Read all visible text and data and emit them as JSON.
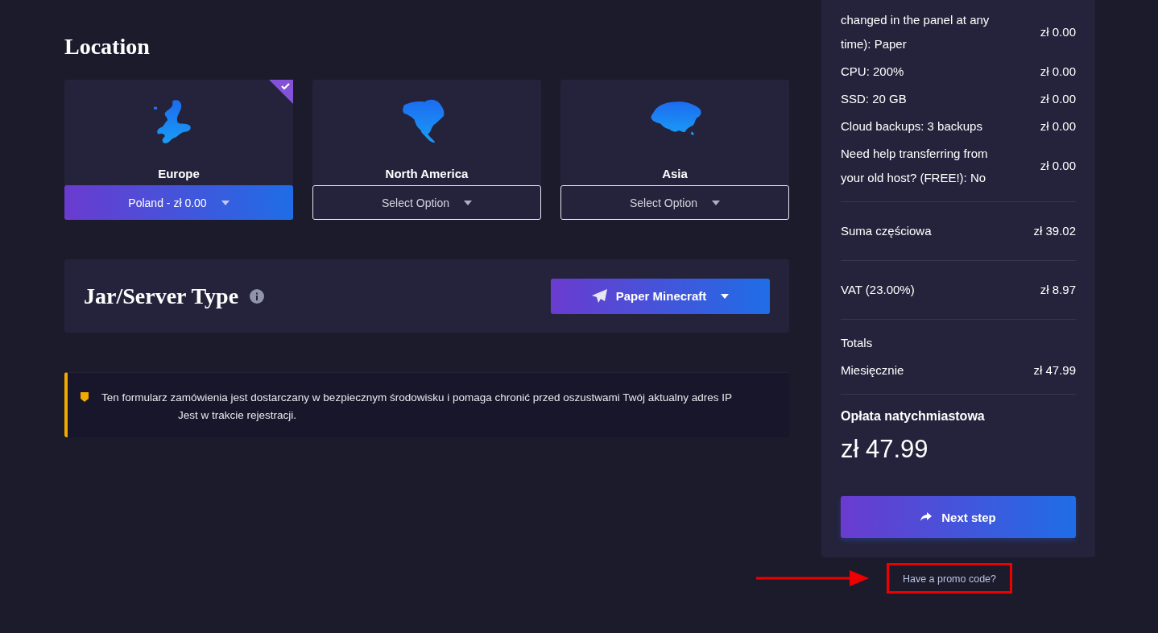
{
  "location": {
    "heading": "Location",
    "regions": [
      {
        "name": "Europe",
        "selected": true,
        "option": "Poland - zł 0.00"
      },
      {
        "name": "North America",
        "selected": false,
        "option": "Select Option"
      },
      {
        "name": "Asia",
        "selected": false,
        "option": "Select Option"
      }
    ]
  },
  "server_type": {
    "heading": "Jar/Server Type",
    "value": "Paper Minecraft"
  },
  "notice": {
    "text": "Ten formularz zamówienia jest dostarczany w bezpiecznym środowisku i pomaga chronić przed oszustwami Twój aktualny adres IP",
    "ip_text": "Jest w trakcie rejestracji."
  },
  "summary": {
    "items": [
      {
        "label": "changed in the panel at any time): Paper",
        "price": "zł 0.00"
      },
      {
        "label": "CPU: 200%",
        "price": "zł 0.00"
      },
      {
        "label": "SSD: 20 GB",
        "price": "zł 0.00"
      },
      {
        "label": "Cloud backups: 3 backups",
        "price": "zł 0.00"
      },
      {
        "label": "Need help transferring from your old host? (FREE!): No",
        "price": "zł 0.00"
      }
    ],
    "subtotal": {
      "label": "Suma częściowa",
      "value": "zł 39.02"
    },
    "tax": {
      "label": "VAT (23.00%)",
      "value": "zł 8.97"
    },
    "totals_heading": "Totals",
    "monthly": {
      "label": "Miesięcznie",
      "value": "zł 47.99"
    },
    "due_label": "Opłata natychmiastowa",
    "due_amount": "zł 47.99",
    "next_button": "Next step"
  },
  "promo_link": "Have a promo code?"
}
